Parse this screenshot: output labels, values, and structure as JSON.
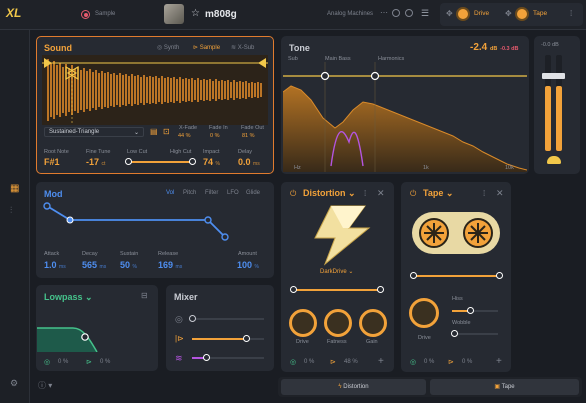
{
  "header": {
    "logo": "XL",
    "sample_label": "Sample",
    "preset_name": "m808g",
    "machine": "Analog Machines",
    "drive_chip": "Drive",
    "tape_chip": "Tape"
  },
  "sound": {
    "title": "Sound",
    "tabs": [
      "Synth",
      "Sample",
      "X-Sub"
    ],
    "waveform_select": "Sustained-Triangle",
    "xfade_label": "X-Fade",
    "xfade_value": "44 %",
    "fadein_label": "Fade In",
    "fadein_value": "0 %",
    "fadeout_label": "Fade Out",
    "fadeout_value": "81 %",
    "params": [
      {
        "label": "Root Note",
        "value": "F#1",
        "unit": ""
      },
      {
        "label": "Fine Tune",
        "value": "-17",
        "unit": "ct"
      },
      {
        "label": "Low Cut",
        "value": "",
        "unit": ""
      },
      {
        "label": "High Cut",
        "value": "",
        "unit": ""
      },
      {
        "label": "Impact",
        "value": "74",
        "unit": "%"
      },
      {
        "label": "Delay",
        "value": "0.0",
        "unit": "ms"
      }
    ]
  },
  "tone": {
    "title": "Tone",
    "level": "-2.4",
    "level_unit": "dB",
    "level_sub": "-0.3 dB",
    "bands": [
      "Sub",
      "Main Bass",
      "Harmonics"
    ],
    "freqs": [
      "Hz",
      "1k",
      "10k"
    ],
    "meter_label": "-0.0 dB"
  },
  "mod": {
    "title": "Mod",
    "tabs": [
      "Vol",
      "Pitch",
      "Filter",
      "LFO",
      "Glide"
    ],
    "params": [
      {
        "label": "Attack",
        "value": "1.0",
        "unit": "ms"
      },
      {
        "label": "Decay",
        "value": "565",
        "unit": "ms"
      },
      {
        "label": "Sustain",
        "value": "50",
        "unit": "%"
      },
      {
        "label": "Release",
        "value": "169",
        "unit": "ms"
      }
    ],
    "amount_label": "Amount",
    "amount_value": "100",
    "amount_unit": "%"
  },
  "distortion": {
    "title": "Distortion",
    "type": "DarkDrive",
    "knobs": [
      "Drive",
      "Fatness",
      "Gain"
    ],
    "footer_a": "0 %",
    "footer_b": "48 %"
  },
  "tape": {
    "title": "Tape",
    "hiss": "Hiss",
    "wobble": "Wobble",
    "drive": "Drive",
    "footer_a": "0 %",
    "footer_b": "0 %"
  },
  "lowpass": {
    "title": "Lowpass",
    "footer_a": "0 %",
    "footer_b": "0 %"
  },
  "mixer": {
    "title": "Mixer"
  },
  "bottom": {
    "distortion_tab": "Distortion",
    "tape_tab": "Tape"
  },
  "colors": {
    "accent": "#f2a23a",
    "blue": "#4e8ef0",
    "green": "#45c28b",
    "purple": "#b455e0"
  }
}
